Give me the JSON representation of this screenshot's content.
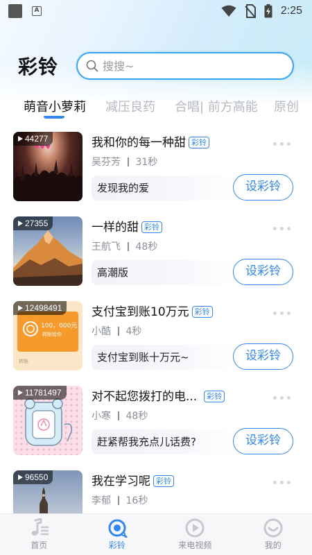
{
  "status_bar": {
    "time": "2:25"
  },
  "header": {
    "title": "彩铃"
  },
  "search": {
    "placeholder": "搜搜~"
  },
  "tabs": [
    {
      "label": "萌音小萝莉",
      "active": true
    },
    {
      "label": "减压良药"
    },
    {
      "label": "合唱| 前方高能"
    },
    {
      "label": "原创"
    }
  ],
  "tag_label": "彩铃",
  "set_button_label": "设彩铃",
  "songs": [
    {
      "play_count": "44277",
      "title": "我和你的每一种甜",
      "artist": "吴芬芳",
      "duration": "31秒",
      "description": "发现我的爱",
      "thumb": "concert-crowd"
    },
    {
      "play_count": "27355",
      "title": "一样的甜",
      "artist": "王航飞",
      "duration": "48秒",
      "description": "高潮版",
      "thumb": "mountain-sunset"
    },
    {
      "play_count": "12498491",
      "title": "支付宝到账10万元",
      "artist": "小酷",
      "duration": "4秒",
      "description": "支付宝到账十万元~",
      "thumb": "transfer-card",
      "thumb_amount": "100，000元",
      "thumb_sub": "转账给你",
      "thumb_footer": "转账"
    },
    {
      "play_count": "11781497",
      "title": "对不起您拨打的电...",
      "artist": "小寒",
      "duration": "48秒",
      "description": "赶紧帮我充点儿话费?",
      "thumb": "cartoon-phone"
    },
    {
      "play_count": "96550",
      "title": "我在学习呢",
      "artist": "李郁",
      "duration": "16秒",
      "description": "",
      "thumb": "church-tower"
    }
  ],
  "bottom_nav": [
    {
      "label": "首页",
      "icon": "music-note-icon"
    },
    {
      "label": "彩铃",
      "icon": "ringtone-icon",
      "active": true
    },
    {
      "label": "来电视频",
      "icon": "play-circle-icon"
    },
    {
      "label": "我的",
      "icon": "profile-icon"
    }
  ],
  "colors": {
    "accent": "#2f87ef",
    "search_border": "#3aa3f0",
    "muted": "#8a8f98"
  }
}
